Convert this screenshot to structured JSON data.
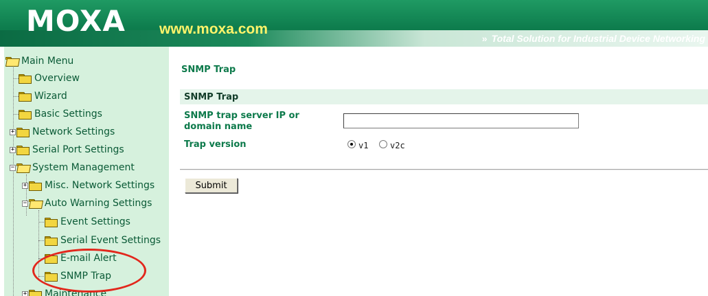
{
  "header": {
    "logo": "MOXA",
    "url": "www.moxa.com",
    "tagline": "Total Solution for Industrial Device Networking",
    "tagline_icon": "double-chevron-right-icon"
  },
  "sidebar": {
    "items": [
      {
        "label": "Main Menu",
        "expander": ""
      },
      {
        "label": "Overview",
        "expander": ""
      },
      {
        "label": "Wizard",
        "expander": ""
      },
      {
        "label": "Basic Settings",
        "expander": ""
      },
      {
        "label": "Network Settings",
        "expander": "+"
      },
      {
        "label": "Serial Port Settings",
        "expander": "+"
      },
      {
        "label": "System Management",
        "expander": "−"
      },
      {
        "label": "Misc. Network Settings",
        "expander": "+"
      },
      {
        "label": "Auto Warning Settings",
        "expander": "−"
      },
      {
        "label": "Event Settings",
        "expander": ""
      },
      {
        "label": "Serial Event Settings",
        "expander": ""
      },
      {
        "label": "E-mail Alert",
        "expander": ""
      },
      {
        "label": "SNMP Trap",
        "expander": ""
      },
      {
        "label": "Maintenance",
        "expander": "+"
      }
    ]
  },
  "main": {
    "page_title": "SNMP Trap",
    "section_title": "SNMP Trap",
    "server_label": "SNMP trap server IP or domain name",
    "server_value": "",
    "version_label": "Trap version",
    "version_options": [
      "v1",
      "v2c"
    ],
    "version_selected": "v1",
    "submit_label": "Submit"
  },
  "annotation": {
    "color": "#e2271c",
    "highlights": "SNMP Trap"
  }
}
